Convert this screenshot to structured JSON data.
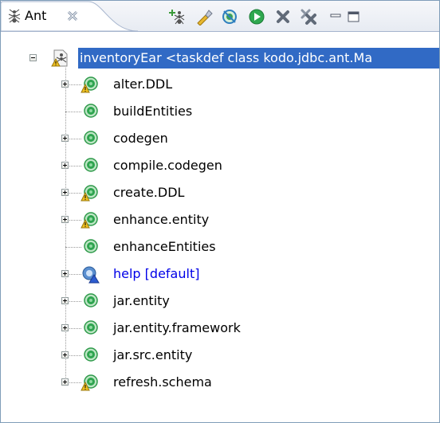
{
  "view": {
    "tab_label": "Ant"
  },
  "toolbar": {
    "buttons": [
      {
        "name": "add-buildfiles",
        "icon": "ant-add-icon"
      },
      {
        "name": "search-buildfiles",
        "icon": "search-flashlight-icon"
      },
      {
        "name": "hide-internal-targets",
        "icon": "filter-targets-icon"
      },
      {
        "name": "run-target",
        "icon": "run-icon"
      },
      {
        "name": "remove-buildfile",
        "icon": "remove-icon"
      },
      {
        "name": "remove-all-buildfiles",
        "icon": "remove-all-icon"
      }
    ]
  },
  "tree": {
    "root": {
      "label": "inventoryEar <taskdef class kodo.jdbc.ant.Ma",
      "icon": "buildfile-warning-icon",
      "expanded": true
    },
    "targets": [
      {
        "label": "alter.DDL",
        "expandable": true,
        "warning": true
      },
      {
        "label": "buildEntities",
        "expandable": false,
        "warning": false
      },
      {
        "label": "codegen",
        "expandable": true,
        "warning": false
      },
      {
        "label": "compile.codegen",
        "expandable": true,
        "warning": false
      },
      {
        "label": "create.DDL",
        "expandable": true,
        "warning": true
      },
      {
        "label": "enhance.entity",
        "expandable": true,
        "warning": true
      },
      {
        "label": "enhanceEntities",
        "expandable": false,
        "warning": false
      },
      {
        "label": "help [default]",
        "expandable": true,
        "warning": false,
        "is_default": true
      },
      {
        "label": "jar.entity",
        "expandable": true,
        "warning": false
      },
      {
        "label": "jar.entity.framework",
        "expandable": true,
        "warning": false
      },
      {
        "label": "jar.src.entity",
        "expandable": true,
        "warning": false
      },
      {
        "label": "refresh.schema",
        "expandable": true,
        "warning": true
      }
    ]
  },
  "colors": {
    "selection": "#316ac5",
    "target_green": "#2ea44f",
    "default_target": "#0000e8",
    "warning": "#f0c020"
  }
}
